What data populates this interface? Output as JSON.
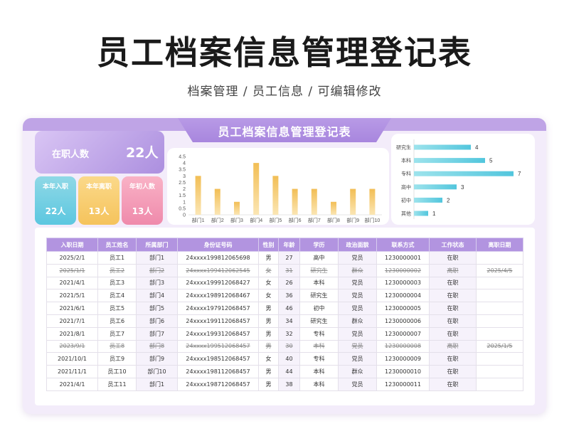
{
  "header": {
    "title": "员工档案信息管理登记表",
    "subtitle": "档案管理 / 员工信息 /  可编辑修改"
  },
  "card": {
    "title": "员工档案信息管理登记表"
  },
  "stats": {
    "active_label": "在职人数",
    "active_value": "22人",
    "joined_label": "本年入职",
    "joined_value": "22人",
    "left_label": "本年离职",
    "left_value": "13人",
    "start_label": "年初人数",
    "start_value": "13人"
  },
  "colors": {
    "accent": "#b294e0",
    "bar_yellow": "#f5c35c",
    "bar_teal": "#5cc7e0"
  },
  "chart_data": [
    {
      "type": "bar",
      "categories": [
        "部门1",
        "部门2",
        "部门3",
        "部门4",
        "部门5",
        "部门6",
        "部门7",
        "部门8",
        "部门9",
        "部门10"
      ],
      "values": [
        3,
        2,
        1,
        4,
        3,
        2,
        2,
        1,
        2,
        2
      ],
      "ylim": [
        0,
        4.5
      ],
      "yticks": [
        "4.5",
        "4",
        "3.5",
        "3",
        "2.5",
        "2",
        "1.5",
        "1",
        "0.5",
        "0"
      ],
      "grid": false
    },
    {
      "type": "bar",
      "orientation": "horizontal",
      "categories": [
        "研究生",
        "本科",
        "专科",
        "高中",
        "初中",
        "其他"
      ],
      "values": [
        4,
        5,
        7,
        3,
        2,
        1
      ],
      "grid": false
    }
  ],
  "table": {
    "columns": [
      "入职日期",
      "员工姓名",
      "所属部门",
      "身份证号码",
      "性别",
      "年龄",
      "学历",
      "政治面貌",
      "联系方式",
      "工作状态",
      "离职日期"
    ],
    "rows": [
      [
        "2025/2/1",
        "员工1",
        "部门1",
        "24xxxx199812065698",
        "男",
        "27",
        "高中",
        "党员",
        "1230000001",
        "在职",
        ""
      ],
      [
        "2025/1/1",
        "员工2",
        "部门2",
        "24xxxx199412062545",
        "女",
        "31",
        "研究生",
        "群众",
        "1230000002",
        "离职",
        "2025/4/5"
      ],
      [
        "2021/4/1",
        "员工3",
        "部门3",
        "24xxxx199912068427",
        "女",
        "26",
        "本科",
        "党员",
        "1230000003",
        "在职",
        ""
      ],
      [
        "2021/5/1",
        "员工4",
        "部门4",
        "24xxxx198912068467",
        "女",
        "36",
        "研究生",
        "党员",
        "1230000004",
        "在职",
        ""
      ],
      [
        "2021/6/1",
        "员工5",
        "部门5",
        "24xxxx197912068457",
        "男",
        "46",
        "初中",
        "党员",
        "1230000005",
        "在职",
        ""
      ],
      [
        "2021/7/1",
        "员工6",
        "部门6",
        "24xxxx199112068457",
        "男",
        "34",
        "研究生",
        "群众",
        "1230000006",
        "在职",
        ""
      ],
      [
        "2021/8/1",
        "员工7",
        "部门7",
        "24xxxx199312068457",
        "男",
        "32",
        "专科",
        "党员",
        "1230000007",
        "在职",
        ""
      ],
      [
        "2023/9/1",
        "员工8",
        "部门8",
        "24xxxx199512068457",
        "男",
        "30",
        "本科",
        "党员",
        "1230000008",
        "离职",
        "2025/1/5"
      ],
      [
        "2021/10/1",
        "员工9",
        "部门9",
        "24xxxx198512068457",
        "女",
        "40",
        "专科",
        "党员",
        "1230000009",
        "在职",
        ""
      ],
      [
        "2021/11/1",
        "员工10",
        "部门10",
        "24xxxx198112068457",
        "男",
        "44",
        "本科",
        "群众",
        "1230000010",
        "在职",
        ""
      ],
      [
        "2021/4/1",
        "员工11",
        "部门1",
        "24xxxx198712068457",
        "男",
        "38",
        "本科",
        "党员",
        "1230000011",
        "在职",
        ""
      ]
    ],
    "left_status": "离职"
  }
}
